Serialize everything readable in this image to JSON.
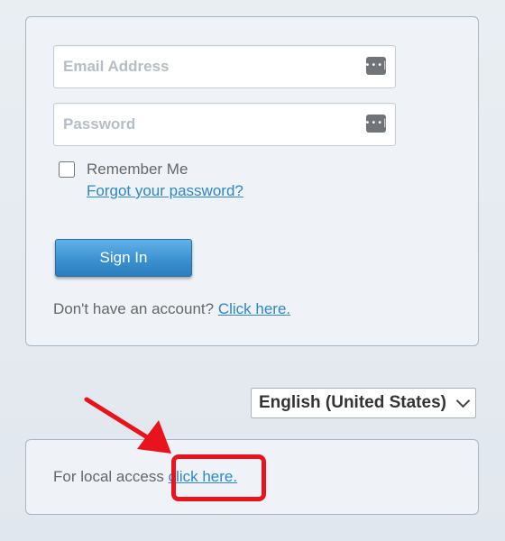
{
  "login": {
    "email_placeholder": "Email Address",
    "password_placeholder": "Password",
    "field_icon": "password-manager-key-icon",
    "remember_label": "Remember Me",
    "forgot_label": "Forgot your password?",
    "signin_label": "Sign In",
    "no_account_text": "Don't have an account?",
    "signup_link": "Click here."
  },
  "language": {
    "selected": "English (United States)"
  },
  "local_access": {
    "text": "For local access",
    "link": "click here."
  },
  "annotation": {
    "color": "#e8131c"
  },
  "colors": {
    "accent": "#3b91d0",
    "link": "#2f86c8"
  }
}
